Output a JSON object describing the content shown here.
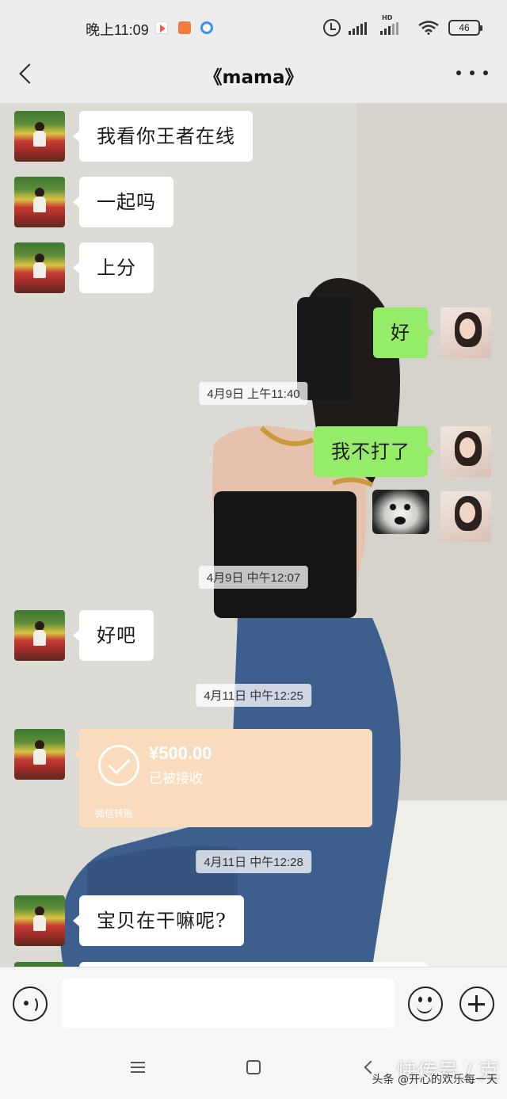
{
  "status_bar": {
    "time": "晚上11:09",
    "battery": "46"
  },
  "nav": {
    "title": "《mama》"
  },
  "messages": {
    "m1": "我看你王者在线",
    "m2": "一起吗",
    "m3": "上分",
    "m4": "好",
    "m5": "我不打了",
    "m6": "好吧",
    "m7": "宝贝在干嘛呢?"
  },
  "timestamps": {
    "t1": "4月9日 上午11:40",
    "t2": "4月9日 中午12:07",
    "t3": "4月11日 中午12:25",
    "t4": "4月11日 中午12:28"
  },
  "transfer": {
    "amount": "¥500.00",
    "status": "已被接收",
    "label": "微信转账"
  },
  "input": {
    "value": ""
  },
  "watermark": {
    "main": "快传号 / 克",
    "sub": "头条 @开心的欢乐每一天"
  }
}
